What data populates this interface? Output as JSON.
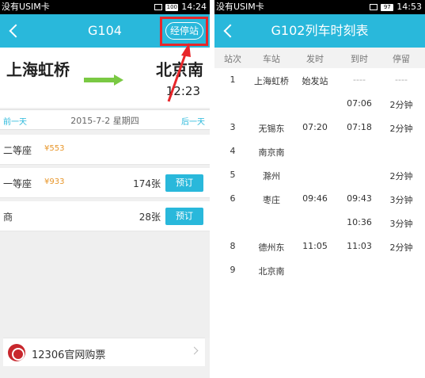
{
  "left": {
    "status": {
      "carrier": "没有USIM卡",
      "time": "14:24"
    },
    "title": "G104",
    "stops_button": "经停站",
    "route": {
      "from": "上海虹桥",
      "to": "北京南",
      "arrive_time": "12:23"
    },
    "date_bar": {
      "prev": "前一天",
      "date": "2015-7-2 星期四",
      "next": "后一天"
    },
    "seats": [
      {
        "name": "二等座",
        "price": "¥553",
        "count": "",
        "button": ""
      },
      {
        "name": "一等座",
        "price": "¥933",
        "count": "174张",
        "button": "预订"
      },
      {
        "name": "商",
        "price": "",
        "count": "28张",
        "button": "预订"
      }
    ],
    "buy_link": "12306官网购票"
  },
  "right": {
    "status": {
      "carrier": "没有USIM卡",
      "time": "14:53"
    },
    "title": "G102列车时刻表",
    "headers": [
      "站次",
      "车站",
      "发时",
      "到时",
      "停留"
    ],
    "rows": [
      [
        "1",
        "上海虹桥",
        "始发站",
        "----",
        "----"
      ],
      [
        "",
        "",
        "",
        "07:06",
        "2分钟"
      ],
      [
        "3",
        "无锡东",
        "07:20",
        "07:18",
        "2分钟"
      ],
      [
        "4",
        "南京南",
        "",
        "",
        ""
      ],
      [
        "5",
        "滁州",
        "",
        "",
        "2分钟"
      ],
      [
        "6",
        "枣庄",
        "09:46",
        "09:43",
        "3分钟"
      ],
      [
        "",
        "",
        "",
        "10:36",
        "3分钟"
      ],
      [
        "8",
        "德州东",
        "11:05",
        "11:03",
        "2分钟"
      ],
      [
        "9",
        "北京南",
        "",
        "",
        ""
      ]
    ]
  },
  "colors": {
    "accent": "#29b8db",
    "highlight": "#e8262a",
    "price": "#e8962a",
    "green": "#7ac943"
  }
}
